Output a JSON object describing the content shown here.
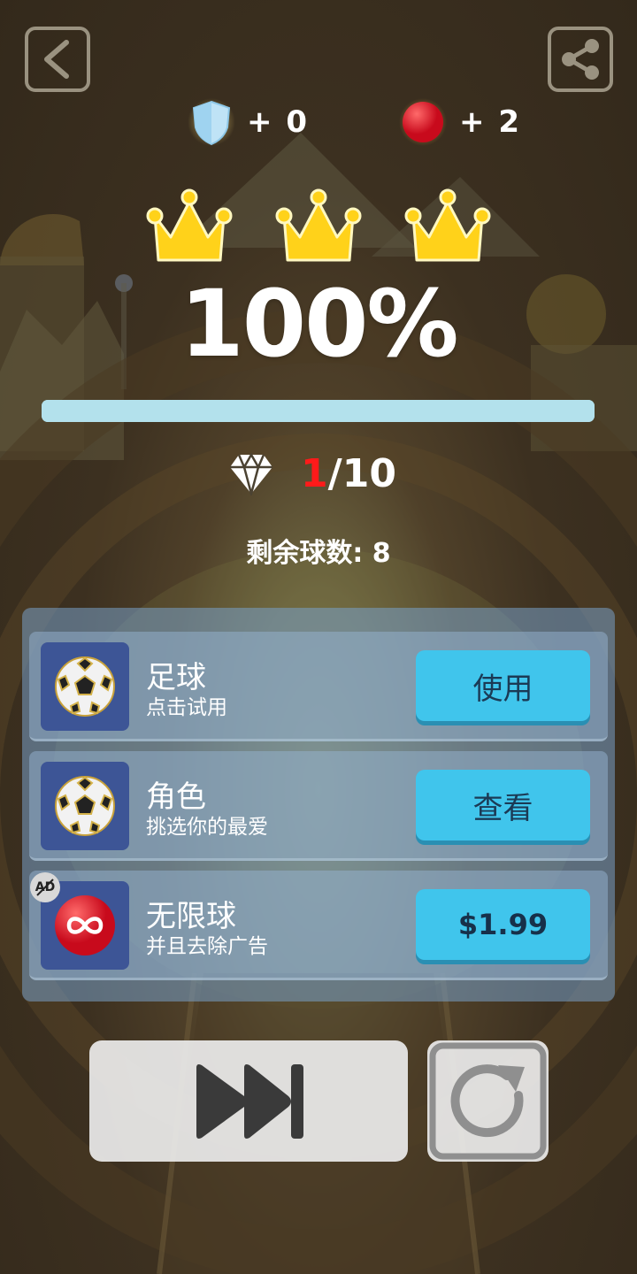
{
  "rewards": {
    "shield": {
      "icon": "shield-icon",
      "text": "+ 0"
    },
    "ball": {
      "icon": "red-ball-icon",
      "text": "+ 2"
    }
  },
  "crowns": {
    "earned": 3,
    "total": 3
  },
  "progress": {
    "label": "100%",
    "fraction": 1.0
  },
  "gems": {
    "collected": "1",
    "separator": "/",
    "total": "10"
  },
  "balls_left": "剩余球数: 8",
  "offers": [
    {
      "title": "足球",
      "subtitle": "点击试用",
      "button": "使用",
      "icon": "soccer-ball-icon"
    },
    {
      "title": "角色",
      "subtitle": "挑选你的最爱",
      "button": "查看",
      "icon": "soccer-ball-icon"
    },
    {
      "title": "无限球",
      "subtitle": "并且去除广告",
      "button": "$1.99",
      "icon": "infinity-ball-icon",
      "badge": "AD"
    }
  ],
  "colors": {
    "accent_button": "#40c5ec",
    "gem_collected": "#ff1a1a",
    "crown": "#ffd21a",
    "progress": "#a9dbe8"
  }
}
